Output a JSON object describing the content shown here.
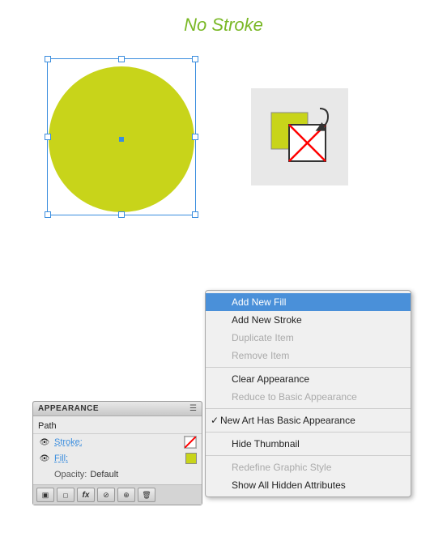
{
  "title": "No Stroke",
  "title_color": "#7ab826",
  "panel": {
    "title": "APPEARANCE",
    "path_label": "Path",
    "stroke_label": "Stroke:",
    "fill_label": "Fill:",
    "opacity_label": "Opacity:",
    "opacity_value": "Default"
  },
  "menu": {
    "items": [
      {
        "id": "add-new-fill",
        "label": "Add New Fill",
        "state": "highlighted",
        "disabled": false,
        "checked": false
      },
      {
        "id": "add-new-stroke",
        "label": "Add New Stroke",
        "state": "normal",
        "disabled": false,
        "checked": false
      },
      {
        "id": "duplicate-item",
        "label": "Duplicate Item",
        "state": "normal",
        "disabled": true,
        "checked": false
      },
      {
        "id": "remove-item",
        "label": "Remove Item",
        "state": "normal",
        "disabled": true,
        "checked": false
      },
      {
        "id": "sep1",
        "type": "separator"
      },
      {
        "id": "clear-appearance",
        "label": "Clear Appearance",
        "state": "normal",
        "disabled": false,
        "checked": false
      },
      {
        "id": "reduce-basic",
        "label": "Reduce to Basic Appearance",
        "state": "normal",
        "disabled": true,
        "checked": false
      },
      {
        "id": "sep2",
        "type": "separator"
      },
      {
        "id": "new-art-basic",
        "label": "New Art Has Basic Appearance",
        "state": "normal",
        "disabled": false,
        "checked": true
      },
      {
        "id": "sep3",
        "type": "separator"
      },
      {
        "id": "hide-thumbnail",
        "label": "Hide Thumbnail",
        "state": "normal",
        "disabled": false,
        "checked": false
      },
      {
        "id": "sep4",
        "type": "separator"
      },
      {
        "id": "redefine-style",
        "label": "Redefine Graphic Style",
        "state": "normal",
        "disabled": true,
        "checked": false
      },
      {
        "id": "show-hidden",
        "label": "Show All Hidden Attributes",
        "state": "normal",
        "disabled": false,
        "checked": false
      }
    ]
  },
  "panel_buttons": [
    "square-icon",
    "rounded-icon",
    "fx-icon",
    "delete-icon",
    "new-item-icon",
    "trash-icon"
  ]
}
